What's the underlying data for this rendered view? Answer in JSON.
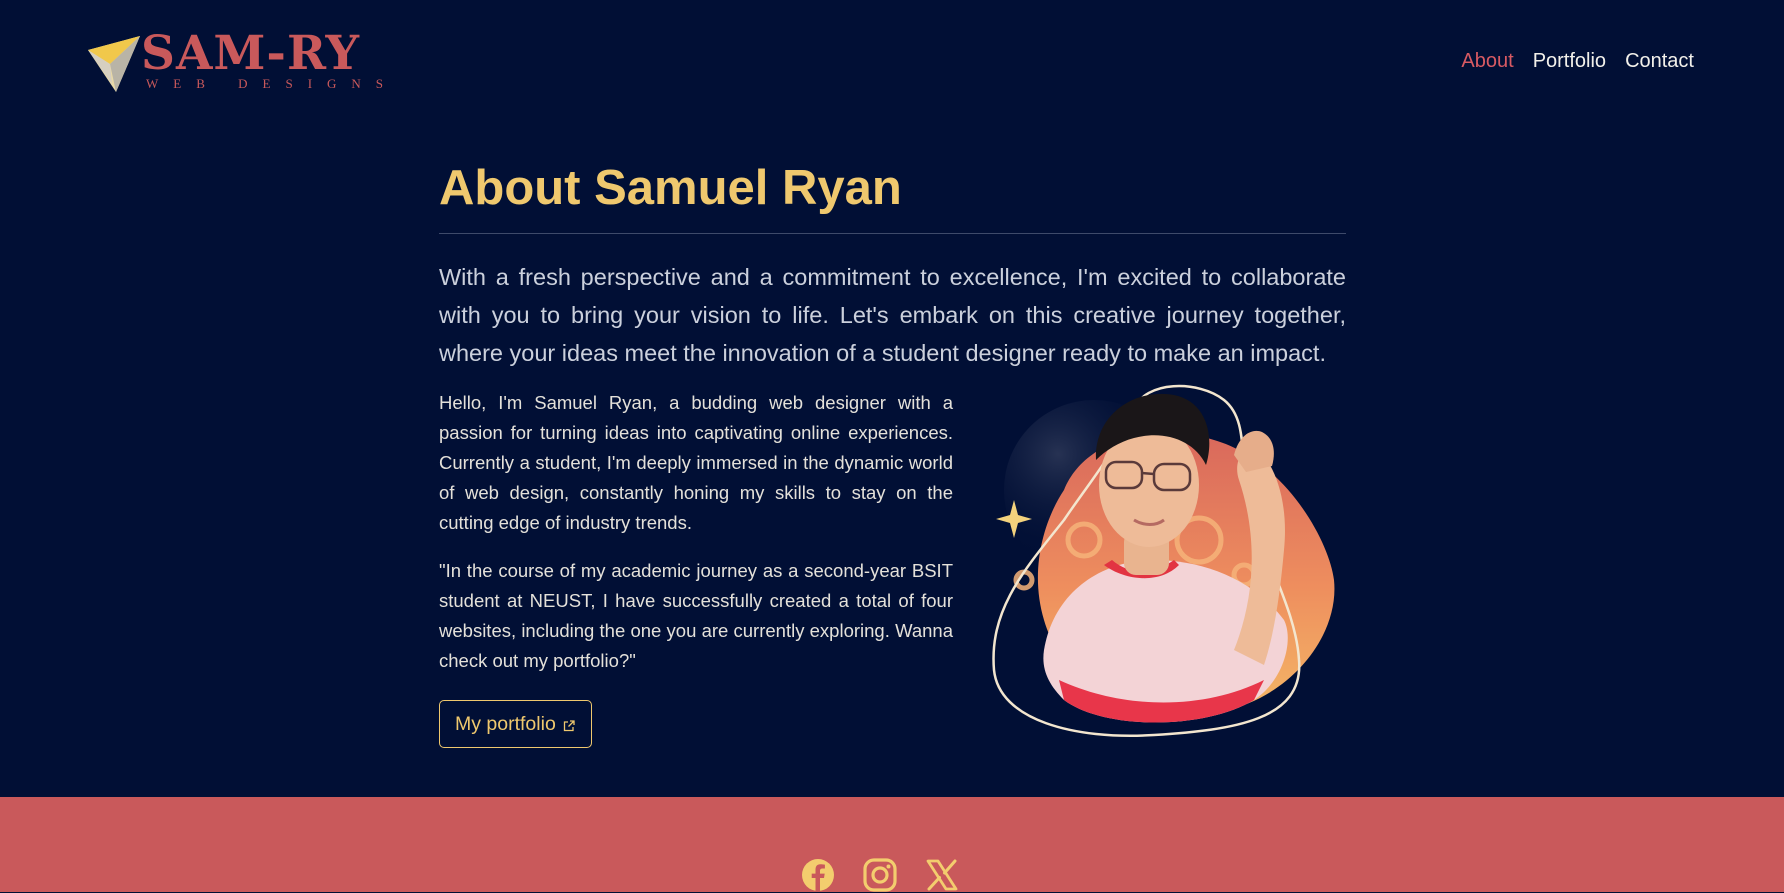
{
  "brand": {
    "name": "SAM-RY",
    "tagline": "WEB DESIGNS",
    "logo_icon": "paper-plane-icon",
    "color": "#c9595b"
  },
  "nav": {
    "items": [
      {
        "label": "About",
        "active": true
      },
      {
        "label": "Portfolio",
        "active": false
      },
      {
        "label": "Contact",
        "active": false
      }
    ],
    "active_color": "#d85a63"
  },
  "about": {
    "title": "About Samuel Ryan",
    "lead": "With a fresh perspective and a commitment to excellence, I'm excited to collaborate with you to bring your vision to life. Let's embark on this creative journey together, where your ideas meet the innovation of a student designer ready to make an impact.",
    "paragraph1": "Hello, I'm Samuel Ryan, a budding web designer with a passion for turning ideas into captivating online experiences. Currently a student, I'm deeply immersed in the dynamic world of web design, constantly honing my skills to stay on the cutting edge of industry trends.",
    "paragraph2": "\"In the course of my academic journey as a second-year BSIT student at NEUST, I have successfully created a total of four websites, including the one you are currently exploring. Wanna check out my portfolio?\"",
    "button_label": "My portfolio",
    "button_icon": "external-link-icon",
    "photo_icon": "profile-photo"
  },
  "footer": {
    "socials": [
      "facebook-icon",
      "instagram-icon",
      "x-twitter-icon"
    ],
    "background": "#c9595b",
    "icon_color": "#f3cd6e"
  },
  "colors": {
    "background": "#010f35",
    "accent_gold": "#efc86e",
    "accent_red": "#c9595b"
  }
}
